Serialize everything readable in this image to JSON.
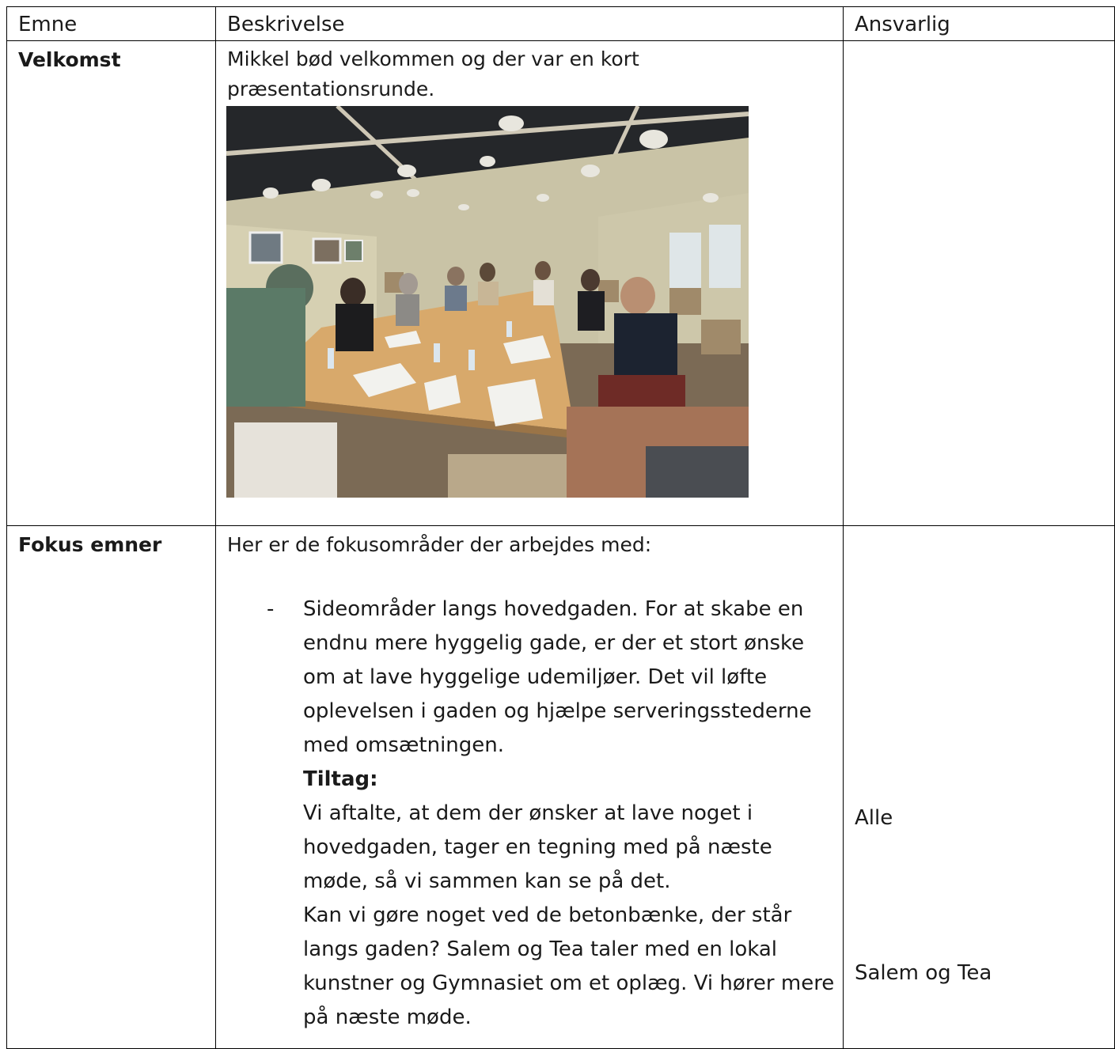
{
  "header": {
    "col_topic": "Emne",
    "col_description": "Beskrivelse",
    "col_responsible": "Ansvarlig"
  },
  "rows": [
    {
      "topic": "Velkomst",
      "description": "Mikkel bød velkommen og der var en kort præsentationsrunde.",
      "responsible": ""
    },
    {
      "topic": "Fokus emner",
      "intro": "Her er de fokusområder der arbejdes med:",
      "bullet_marker": "-",
      "bullet_text": "Sideområder langs hovedgaden. For at skabe en endnu mere hyggelig gade, er der et stort ønske om at lave hyggelige udemiljøer. Det vil løfte oplevelsen i gaden og hjælpe serveringsstederne med omsætningen.",
      "tiltag_heading": "Tiltag:",
      "tiltag_1": "Vi aftalte, at dem der ønsker at lave noget i hovedgaden, tager en tegning med på næste møde, så vi sammen kan se på det.",
      "tiltag_2": "Kan vi gøre noget ved de betonbænke, der står langs gaden? Salem og Tea taler med en lokal kunstner og Gymnasiet om et oplæg. Vi hører mere på næste møde.",
      "responsible_1": "Alle",
      "responsible_2": "Salem og Tea"
    }
  ]
}
